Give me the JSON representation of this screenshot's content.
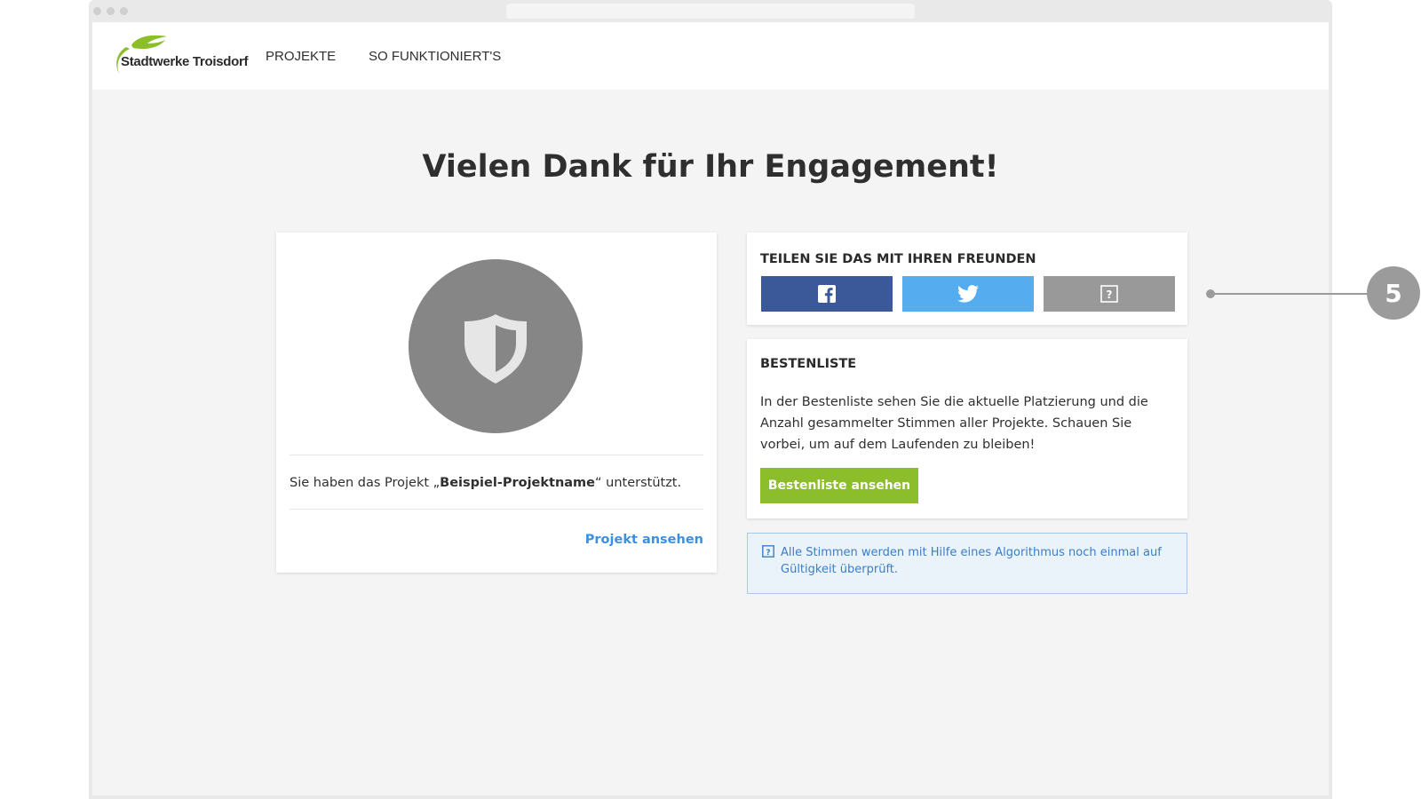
{
  "brand": {
    "name": "Stadtwerke Troisdorf",
    "accent": "#8cbd2a"
  },
  "nav": {
    "items": [
      {
        "label": "PROJEKTE"
      },
      {
        "label": "SO FUNKTIONIERT'S"
      }
    ]
  },
  "main": {
    "title": "Vielen Dank für Ihr Engagement!",
    "project_card": {
      "badge_icon": "shield-icon",
      "text_before": "Sie haben das Projekt „",
      "project_name": "Beispiel-Projektname",
      "text_after": "“ unterstützt.",
      "link_label": "Projekt ansehen"
    },
    "share": {
      "heading": "TEILEN SIE DAS MIT IHREN FREUNDEN",
      "buttons": [
        {
          "icon": "facebook-icon",
          "color": "#3b5998"
        },
        {
          "icon": "twitter-icon",
          "color": "#55acee"
        },
        {
          "icon": "help-icon",
          "color": "#999999"
        }
      ]
    },
    "leaderboard": {
      "heading": "BESTENLISTE",
      "text": "In der Bestenliste sehen Sie die aktuelle Platzierung und die Anzahl gesammelter Stimmen aller Projekte. Schauen Sie vorbei, um auf dem Laufenden zu bleiben!",
      "button_label": "Bestenliste ansehen"
    },
    "info": {
      "icon": "help-icon",
      "text": "Alle Stimmen werden mit Hilfe eines Algorithmus noch einmal auf Gültigkeit überprüft."
    }
  },
  "annotation": {
    "number": "5"
  }
}
